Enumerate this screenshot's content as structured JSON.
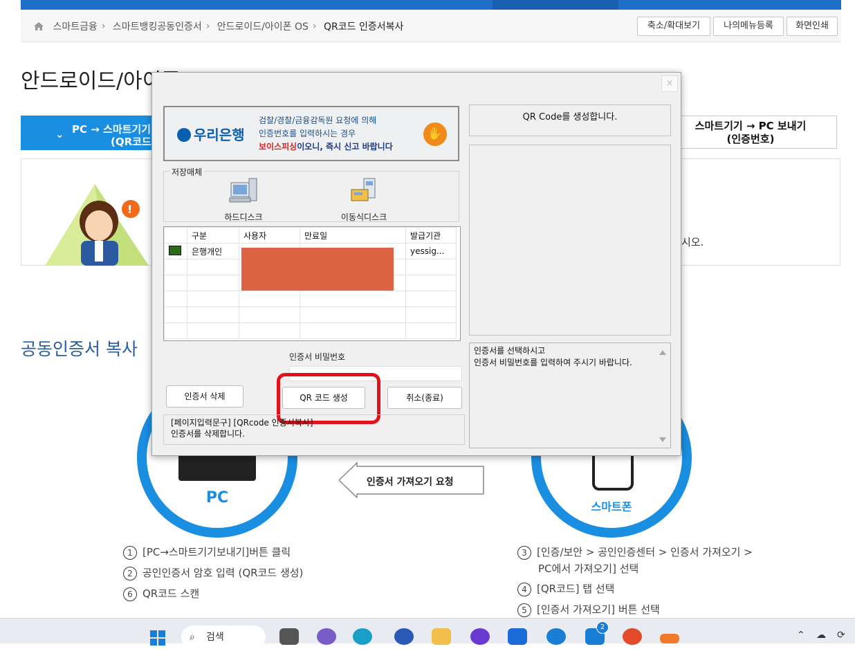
{
  "breadcrumb": {
    "items": [
      "스마트금융",
      "스마트뱅킹공동인증서",
      "안드로이드/아이폰 OS"
    ],
    "current": "QR코드 인증서복사"
  },
  "toolbar": {
    "zoom": "축소/확대보기",
    "mymenu": "나의메뉴등록",
    "print": "화면인쇄"
  },
  "page": {
    "title": "안드로이드/아이폰 OS",
    "tab_left_line1": "PC → 스마트기기",
    "tab_left_line2": "(QR코드)",
    "tab_right_line1": "스마트기기 → PC 보내기",
    "tab_right_line2": "(인증번호)",
    "info_tail": "시오.",
    "section_title": "공동인증서 복사",
    "pc_label": "PC",
    "phone_label": "스마트폰",
    "arrow_label": "인증서 가져오기 요청"
  },
  "steps_left": [
    {
      "num": "1",
      "text": "[PC→스마트기기보내기]버튼 클릭"
    },
    {
      "num": "2",
      "text": "공인인증서 암호 입력 (QR코드 생성)"
    },
    {
      "num": "6",
      "text": "QR코드 스캔"
    }
  ],
  "steps_right": [
    {
      "num": "3",
      "text": "[인증/보안 > 공인인증센터 > 인증서 가져오기 >"
    },
    {
      "num": "",
      "text": "PC에서 가져오기] 선택"
    },
    {
      "num": "4",
      "text": "[QR코드] 탭 선택"
    },
    {
      "num": "5",
      "text": "[인증서 가져오기] 버튼 선택"
    }
  ],
  "dialog": {
    "close": "×",
    "bank_logo": "우리은행",
    "banner_line1": "검찰/경찰/금융감독원 요청에 의해",
    "banner_line2": "인증번호를 입력하시는 경우",
    "banner_warn": "보이스피싱",
    "banner_line3_rest": "이오니, 즉시 신고 바랍니다",
    "storage_title": "저장매체",
    "storage_hdd": "하드디스크",
    "storage_removable": "이동식디스크",
    "columns": [
      "구분",
      "사용자",
      "만료일",
      "발급기관"
    ],
    "rows": [
      {
        "type": "은행개인",
        "user": "",
        "expiry": "",
        "issuer": "yessig..."
      }
    ],
    "password_label": "인증서 비밀번호",
    "delete_button": "인증서 삭제",
    "qr_button": "QR 코드 생성",
    "cancel_button": "취소(종료)",
    "status_line1": "[페이지입력문구] [QRcode 인증서복사]",
    "status_line2": "인증서를 삭제합니다.",
    "qr_header": "QR Code를 생성합니다.",
    "message_line1": "인증서를 선택하시고",
    "message_line2": "인증서 비밀번호를 입력하여 주시기 바랍니다."
  },
  "taskbar": {
    "search": "검색",
    "badge": "2"
  },
  "colors": {
    "accent": "#1a8ee0",
    "highlight": "#e2121a",
    "redaction": "#dc6444"
  }
}
